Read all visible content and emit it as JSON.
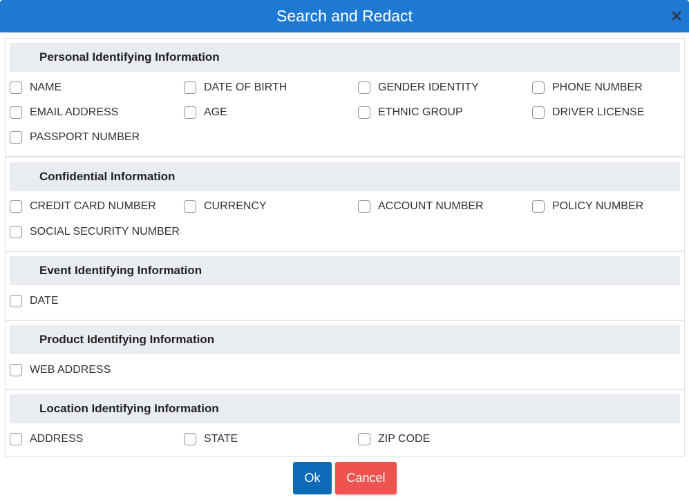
{
  "dialog": {
    "title": "Search and Redact",
    "close_icon": "close-icon"
  },
  "sections": [
    {
      "title": "Personal Identifying Information",
      "options": [
        "NAME",
        "DATE OF BIRTH",
        "GENDER IDENTITY",
        "PHONE NUMBER",
        "EMAIL ADDRESS",
        "AGE",
        "ETHNIC GROUP",
        "DRIVER LICENSE",
        "PASSPORT NUMBER"
      ]
    },
    {
      "title": "Confidential Information",
      "options": [
        "CREDIT CARD NUMBER",
        "CURRENCY",
        "ACCOUNT NUMBER",
        "POLICY NUMBER",
        "SOCIAL SECURITY NUMBER"
      ]
    },
    {
      "title": "Event Identifying Information",
      "options": [
        "DATE"
      ]
    },
    {
      "title": "Product Identifying Information",
      "options": [
        "WEB ADDRESS"
      ]
    },
    {
      "title": "Location Identifying Information",
      "options": [
        "ADDRESS",
        "STATE",
        "ZIP CODE"
      ]
    }
  ],
  "footer": {
    "ok_label": "Ok",
    "cancel_label": "Cancel"
  },
  "colors": {
    "titlebar": "#1e79d4",
    "ok_button": "#0d6ab6",
    "cancel_button": "#ef5350",
    "section_header": "#e9ecf0"
  }
}
